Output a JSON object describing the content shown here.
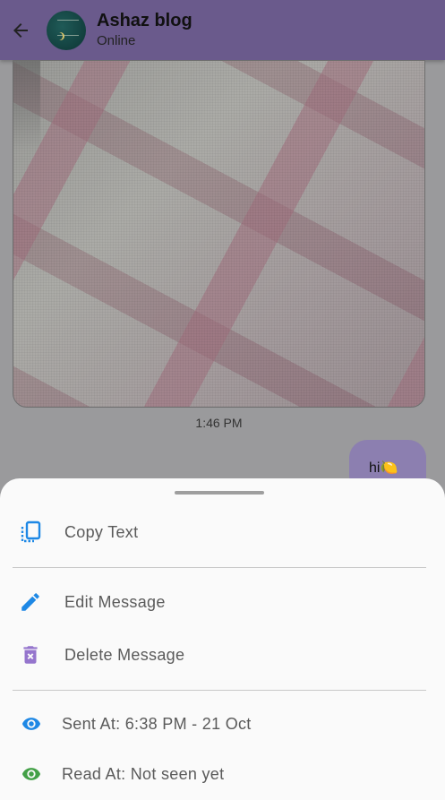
{
  "header": {
    "title": "Ashaz blog",
    "status": "Online"
  },
  "messages": {
    "image_time": "1:46 PM",
    "outgoing_text": "hi🍋"
  },
  "sheet": {
    "copy_label": "Copy Text",
    "edit_label": "Edit Message",
    "delete_label": "Delete Message",
    "sent_label": "Sent At: 6:38 PM - 21 Oct",
    "read_label": "Read At: Not seen yet"
  },
  "colors": {
    "blue_icon": "#1e88e5",
    "purple_icon": "#9575cd",
    "green_icon": "#43a047"
  },
  "icons": {
    "back": "arrow-back-icon",
    "copy": "copy-icon",
    "edit": "pencil-icon",
    "delete": "trash-icon",
    "sent": "eye-icon",
    "read": "eye-icon"
  }
}
